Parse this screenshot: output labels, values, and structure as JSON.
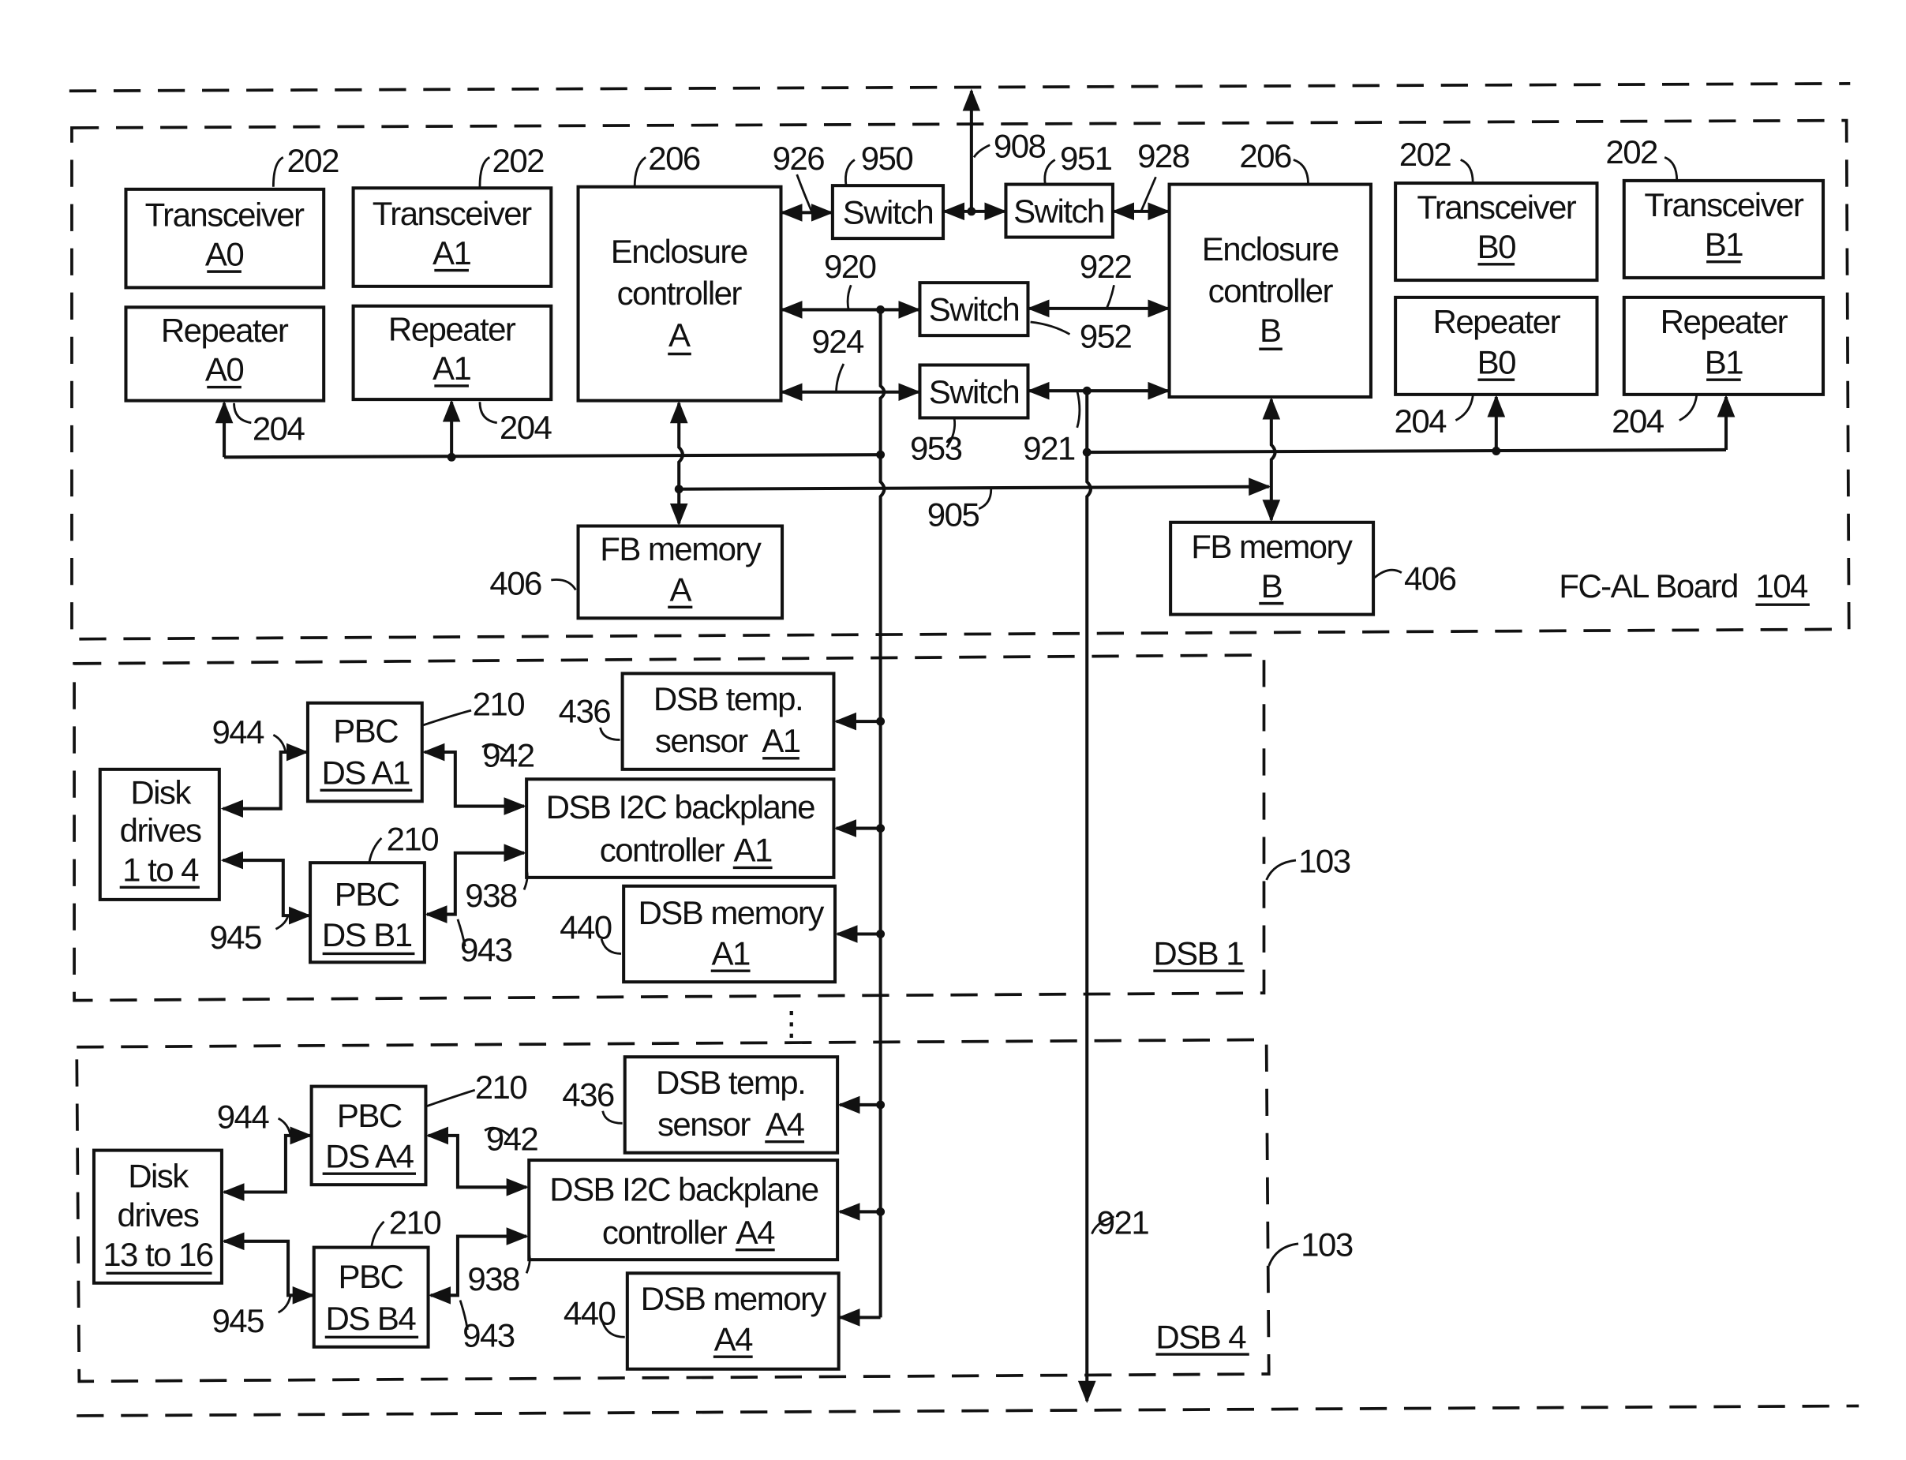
{
  "diagram": {
    "board": {
      "label": "FC-AL Board",
      "ref": "104"
    },
    "transceivers": [
      {
        "title": "Transceiver",
        "id": "A0",
        "ref": "202"
      },
      {
        "title": "Transceiver",
        "id": "A1",
        "ref": "202"
      },
      {
        "title": "Transceiver",
        "id": "B0",
        "ref": "202"
      },
      {
        "title": "Transceiver",
        "id": "B1",
        "ref": "202"
      }
    ],
    "repeaters": [
      {
        "title": "Repeater",
        "id": "A0",
        "ref": "204"
      },
      {
        "title": "Repeater",
        "id": "A1",
        "ref": "204"
      },
      {
        "title": "Repeater",
        "id": "B0",
        "ref": "204"
      },
      {
        "title": "Repeater",
        "id": "B1",
        "ref": "204"
      }
    ],
    "enclosure_controllers": [
      {
        "line1": "Enclosure",
        "line2": "controller",
        "id": "A",
        "ref": "206"
      },
      {
        "line1": "Enclosure",
        "line2": "controller",
        "id": "B",
        "ref": "206"
      }
    ],
    "switches": [
      {
        "label": "Switch",
        "ref": "950"
      },
      {
        "label": "Switch",
        "ref": "951"
      },
      {
        "label": "Switch",
        "ref": "952"
      },
      {
        "label": "Switch",
        "ref": "953"
      }
    ],
    "fb_memory": [
      {
        "title": "FB memory",
        "id": "A",
        "ref": "406"
      },
      {
        "title": "FB memory",
        "id": "B",
        "ref": "406"
      }
    ],
    "bus_refs": {
      "r908": "908",
      "r926": "926",
      "r928": "928",
      "r920": "920",
      "r922": "922",
      "r924": "924",
      "r921": "921",
      "r905": "905",
      "r921b": "921"
    },
    "dsbs": [
      {
        "label": "DSB 1",
        "ref": "103",
        "disk": {
          "line1": "Disk",
          "line2": "drives",
          "range": "1 to 4"
        },
        "pbc_a": {
          "title": "PBC",
          "id": "DS A1",
          "ref": "210"
        },
        "pbc_b": {
          "title": "PBC",
          "id": "DS B1",
          "ref": "210"
        },
        "temp": {
          "line1": "DSB temp.",
          "line2": "sensor",
          "id": "A1",
          "ref": "436"
        },
        "i2c": {
          "line1": "DSB I2C backplane",
          "line2": "controller",
          "id": "A1"
        },
        "mem": {
          "line1": "DSB memory",
          "id": "A1",
          "ref": "440"
        },
        "refs": {
          "r944": "944",
          "r945": "945",
          "r942": "942",
          "r943": "943",
          "r938": "938"
        }
      },
      {
        "label": "DSB 4",
        "ref": "103",
        "disk": {
          "line1": "Disk",
          "line2": "drives",
          "range": "13 to 16"
        },
        "pbc_a": {
          "title": "PBC",
          "id": "DS A4",
          "ref": "210"
        },
        "pbc_b": {
          "title": "PBC",
          "id": "DS B4",
          "ref": "210"
        },
        "temp": {
          "line1": "DSB temp.",
          "line2": "sensor",
          "id": "A4",
          "ref": "436"
        },
        "i2c": {
          "line1": "DSB I2C backplane",
          "line2": "controller",
          "id": "A4"
        },
        "mem": {
          "line1": "DSB memory",
          "id": "A4",
          "ref": "440"
        },
        "refs": {
          "r944": "944",
          "r945": "945",
          "r942": "942",
          "r943": "943",
          "r938": "938"
        }
      }
    ],
    "ellipsis": "⋮"
  }
}
